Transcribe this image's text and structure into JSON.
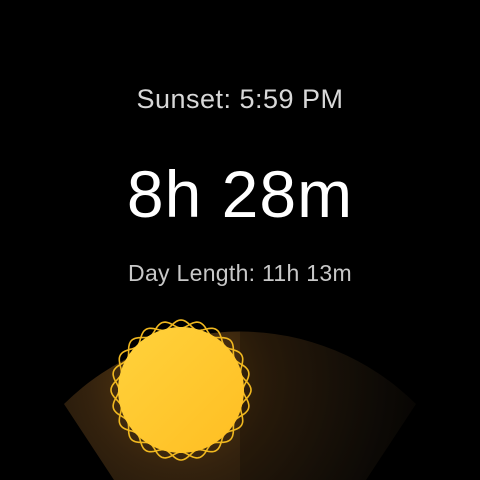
{
  "sunset": {
    "label": "Sunset: 5:59 PM"
  },
  "time_remaining": {
    "value": "8h 28m"
  },
  "day_length": {
    "label": "Day Length: 11h 13m"
  },
  "colors": {
    "background": "#000000",
    "sun_fill": "#ffc42a",
    "sun_outline": "#f5c12a",
    "arc_glow": "#4a2f10"
  },
  "icons": {
    "sun": "sun-icon"
  }
}
